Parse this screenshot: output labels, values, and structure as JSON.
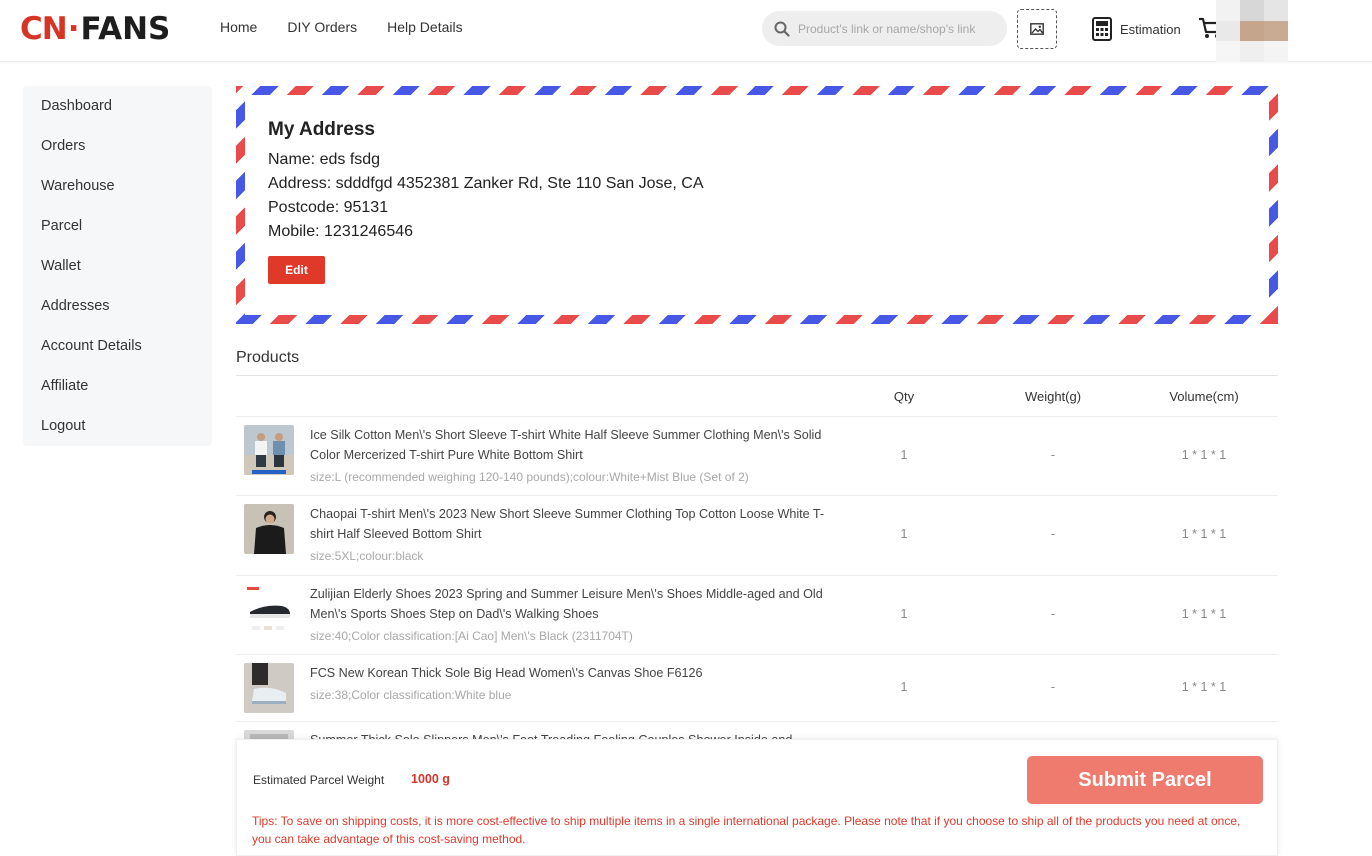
{
  "brand": {
    "logo_left": "CN",
    "logo_dot": "·",
    "logo_right": "FANS"
  },
  "nav": [
    {
      "label": "Home"
    },
    {
      "label": "DIY Orders"
    },
    {
      "label": "Help Details"
    }
  ],
  "search": {
    "placeholder": "Product's link or name/shop's link"
  },
  "header": {
    "estimation_label": "Estimation"
  },
  "sidebar": {
    "items": [
      {
        "label": "Dashboard"
      },
      {
        "label": "Orders"
      },
      {
        "label": "Warehouse"
      },
      {
        "label": "Parcel"
      },
      {
        "label": "Wallet"
      },
      {
        "label": "Addresses"
      },
      {
        "label": "Account Details"
      },
      {
        "label": "Affiliate"
      },
      {
        "label": "Logout"
      }
    ]
  },
  "address": {
    "title": "My Address",
    "name": "Name: eds fsdg",
    "address": "Address: sdddfgd 4352381 Zanker Rd, Ste 110 San Jose, CA",
    "postcode": "Postcode: 95131",
    "mobile": "Mobile: 1231246546",
    "edit_label": "Edit"
  },
  "products": {
    "title": "Products",
    "columns": {
      "qty": "Qty",
      "weight": "Weight(g)",
      "volume": "Volume(cm)"
    },
    "items": [
      {
        "name": "Ice Silk Cotton Men\\'s Short Sleeve T-shirt White Half Sleeve Summer Clothing Men\\'s Solid Color Mercerized T-shirt Pure White Bottom Shirt",
        "spec": "size:L (recommended weighing 120-140 pounds);colour:White+Mist Blue (Set of 2)",
        "qty": "1",
        "weight": "-",
        "volume": "1 * 1 * 1"
      },
      {
        "name": "Chaopai T-shirt Men\\'s 2023 New Short Sleeve Summer Clothing Top Cotton Loose White T-shirt Half Sleeved Bottom Shirt",
        "spec": "size:5XL;colour:black",
        "qty": "1",
        "weight": "-",
        "volume": "1 * 1 * 1"
      },
      {
        "name": "Zulijian Elderly Shoes 2023 Spring and Summer Leisure Men\\'s Shoes Middle-aged and Old Men\\'s Sports Shoes Step on Dad\\'s Walking Shoes",
        "spec": "size:40;Color classification:[Ai Cao] Men\\'s Black (2311704T)",
        "qty": "1",
        "weight": "-",
        "volume": "1 * 1 * 1"
      },
      {
        "name": "FCS New Korean Thick Sole Big Head Women\\'s Canvas Shoe F6126",
        "spec": "size:38;Color classification:White blue",
        "qty": "1",
        "weight": "-",
        "volume": "1 * 1 * 1"
      },
      {
        "name": "Summer Thick Sole Slippers Men\\'s Foot Treading Feeling Couples Shower Inside and Outside Wear",
        "spec": "",
        "qty": "",
        "weight": "",
        "volume": ""
      }
    ]
  },
  "summary": {
    "est_label": "Estimated Parcel Weight",
    "est_value": "1000 g",
    "submit_label": "Submit Parcel",
    "tips": "Tips: To save on shipping costs, it is more cost-effective to ship multiple items in a single international package. Please note that if you choose to ship all of the products you need at once, you can take advantage of this cost-saving method."
  },
  "colors": {
    "accent": "#e0392a",
    "submit": "#ef7b6e",
    "airmail_red": "#e94b4b",
    "airmail_blue": "#4758e6"
  }
}
